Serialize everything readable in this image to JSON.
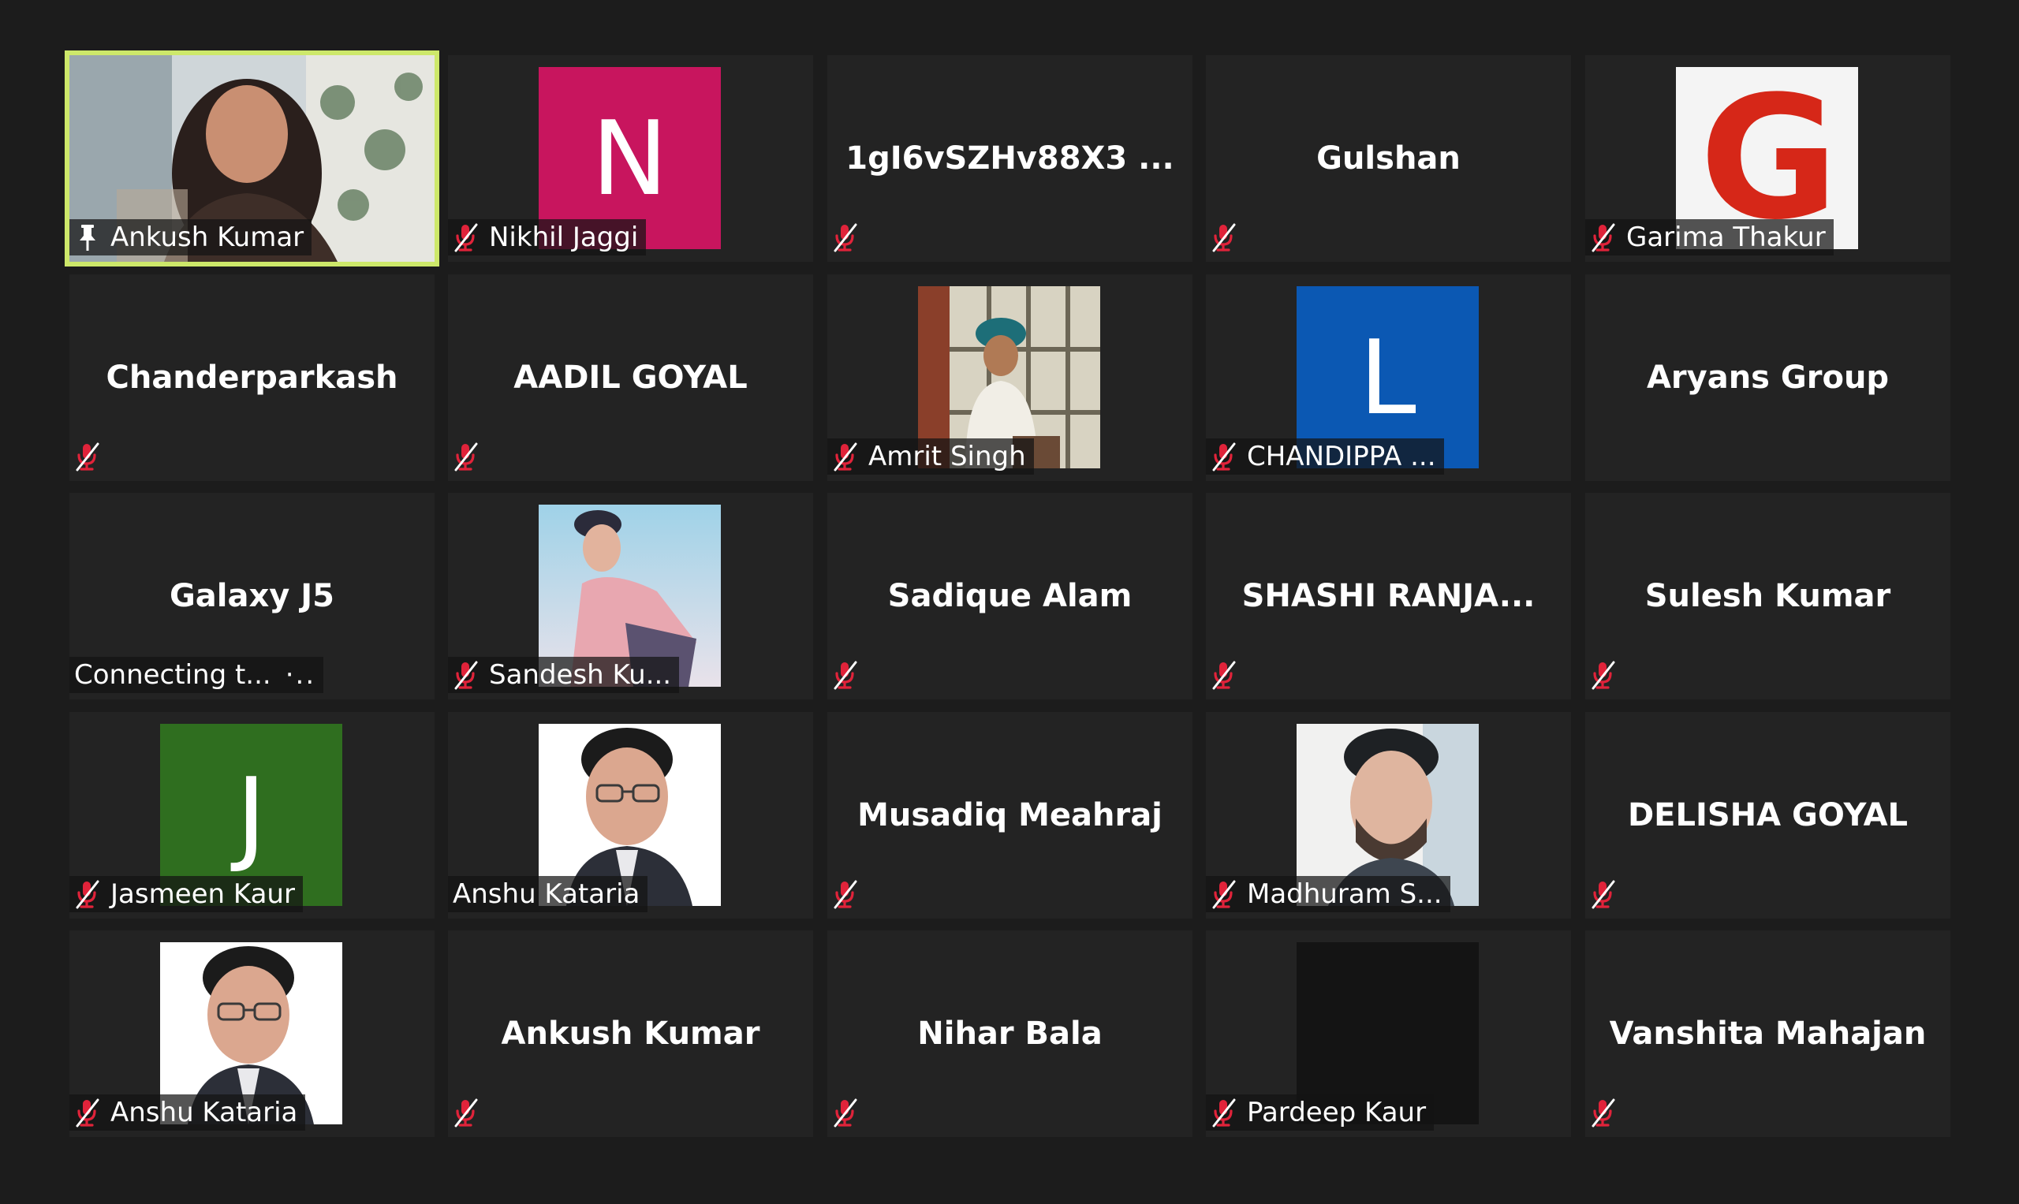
{
  "colors": {
    "background": "#1c1c1c",
    "tile": "#232323",
    "active_speaker_border": "#cde86a",
    "muted_icon": "#e0233a"
  },
  "participants": [
    {
      "name": "Ankush Kumar",
      "center": "",
      "avatar": "photo",
      "photo": "photo-woman-speaker",
      "icon": "pin-icon",
      "active": true
    },
    {
      "name": "Nikhil Jaggi",
      "center": "",
      "avatar": "letter",
      "letter": "N",
      "avatar_color": "#c8155e",
      "icon": "mic-muted-icon"
    },
    {
      "name": "",
      "center": "1gI6vSZHv88X3 ...",
      "avatar": "none",
      "icon": "mic-muted-icon"
    },
    {
      "name": "",
      "center": "Gulshan",
      "avatar": "none",
      "icon": "mic-muted-icon"
    },
    {
      "name": "Garima Thakur",
      "center": "",
      "avatar": "letter-g",
      "letter": "G",
      "avatar_color": "#f4f4f4",
      "icon": "mic-muted-icon"
    },
    {
      "name": "",
      "center": "Chanderparkash",
      "avatar": "none",
      "icon": "mic-muted-icon"
    },
    {
      "name": "",
      "center": "AADIL GOYAL",
      "avatar": "none",
      "icon": "mic-muted-icon"
    },
    {
      "name": "Amrit Singh",
      "center": "",
      "avatar": "photo",
      "photo": "photo-man-turban",
      "icon": "mic-muted-icon"
    },
    {
      "name": "CHANDIPPA ...",
      "center": "",
      "avatar": "letter",
      "letter": "L",
      "avatar_color": "#0b58b3",
      "icon": "mic-muted-icon"
    },
    {
      "name": "",
      "center": "Aryans Group",
      "avatar": "none",
      "icon": "none"
    },
    {
      "name": "Connecting t...",
      "center": "Galaxy J5",
      "avatar": "none",
      "icon": "none",
      "dots": "·.."
    },
    {
      "name": "Sandesh Ku...",
      "center": "",
      "avatar": "photo",
      "photo": "photo-young-man-sky",
      "icon": "mic-muted-icon"
    },
    {
      "name": "",
      "center": "Sadique Alam",
      "avatar": "none",
      "icon": "mic-muted-icon"
    },
    {
      "name": "",
      "center": "SHASHI RANJA...",
      "avatar": "none",
      "icon": "mic-muted-icon"
    },
    {
      "name": "",
      "center": "Sulesh Kumar",
      "avatar": "none",
      "icon": "mic-muted-icon"
    },
    {
      "name": "Jasmeen Kaur",
      "center": "",
      "avatar": "letter",
      "letter": "J",
      "avatar_color": "#2f6e1f",
      "icon": "mic-muted-icon"
    },
    {
      "name": "Anshu Kataria",
      "center": "",
      "avatar": "photo",
      "photo": "photo-man-glasses",
      "icon": "none"
    },
    {
      "name": "",
      "center": "Musadiq Meahraj",
      "avatar": "none",
      "icon": "mic-muted-icon"
    },
    {
      "name": "Madhuram S...",
      "center": "",
      "avatar": "photo",
      "photo": "photo-man-beard",
      "icon": "mic-muted-icon"
    },
    {
      "name": "",
      "center": "DELISHA GOYAL",
      "avatar": "none",
      "icon": "mic-muted-icon"
    },
    {
      "name": "Anshu Kataria",
      "center": "",
      "avatar": "photo",
      "photo": "photo-man-glasses",
      "icon": "mic-muted-icon"
    },
    {
      "name": "",
      "center": "Ankush Kumar",
      "avatar": "none",
      "icon": "mic-muted-icon"
    },
    {
      "name": "",
      "center": "Nihar Bala",
      "avatar": "none",
      "icon": "mic-muted-icon"
    },
    {
      "name": "Pardeep Kaur",
      "center": "",
      "avatar": "dark",
      "avatar_color": "#141414",
      "icon": "mic-muted-icon"
    },
    {
      "name": "",
      "center": "Vanshita Mahajan",
      "avatar": "none",
      "icon": "mic-muted-icon"
    }
  ]
}
